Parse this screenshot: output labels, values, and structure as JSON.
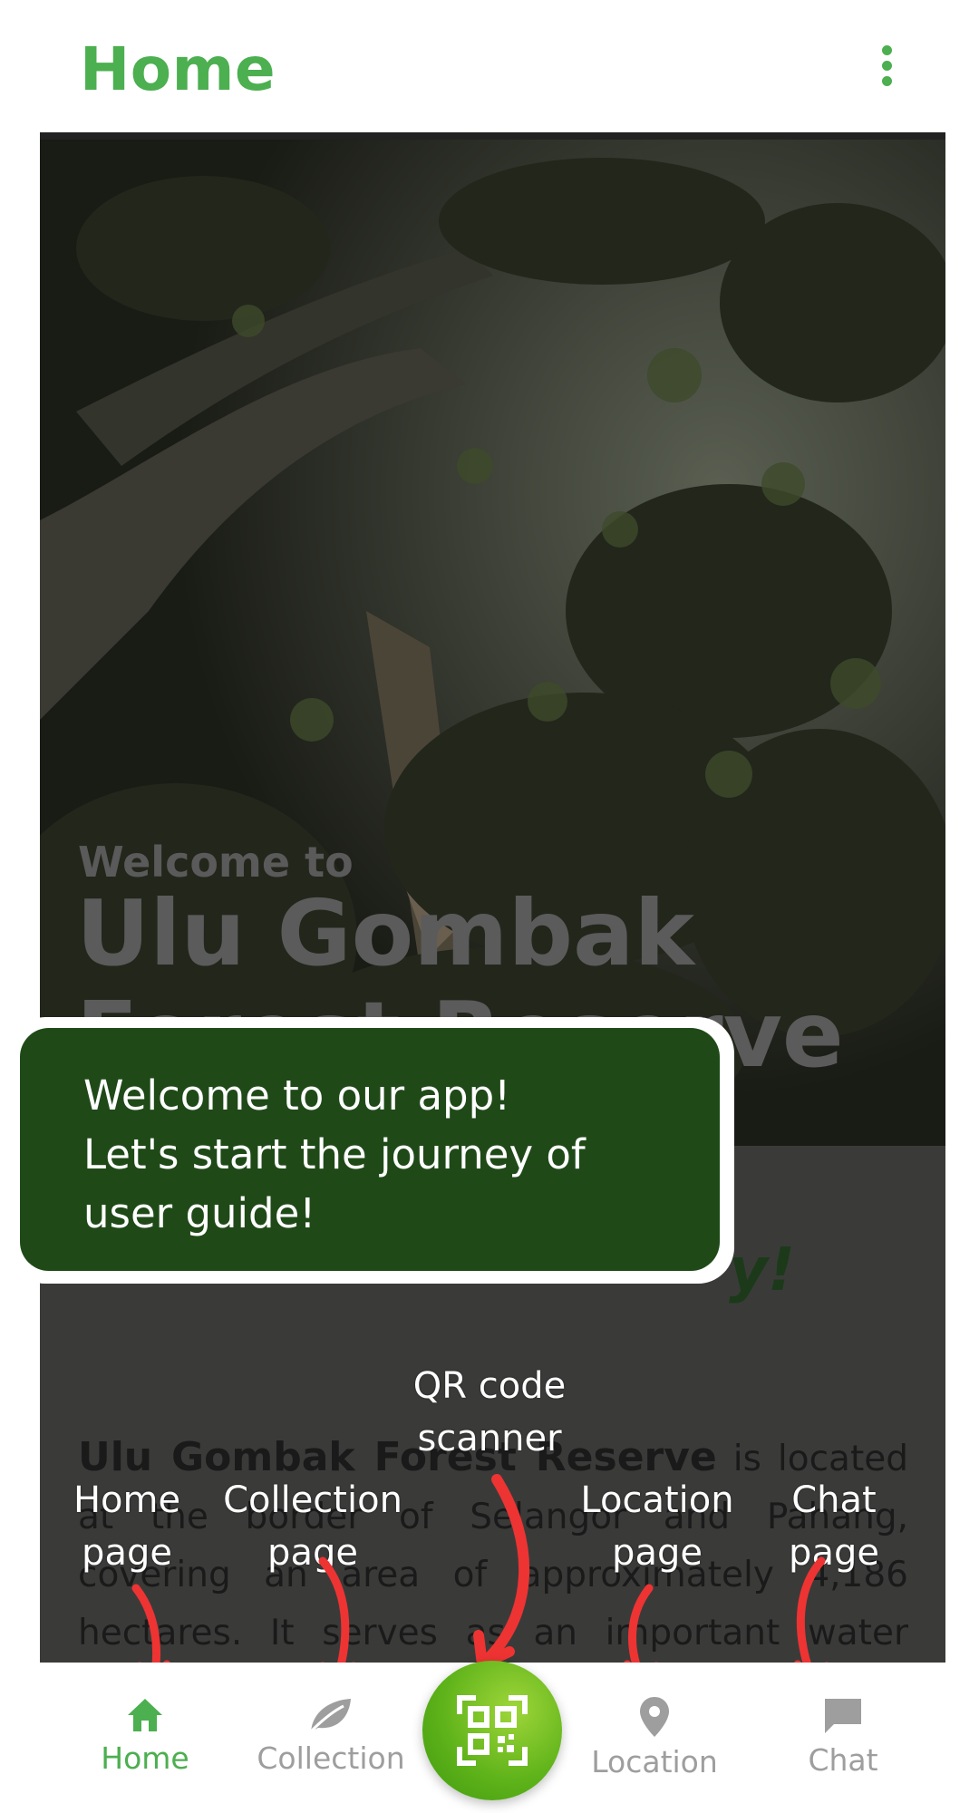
{
  "appbar": {
    "title": "Home"
  },
  "hero": {
    "welcome_small": "Welcome to",
    "welcome_big": "Ulu Gombak Forest Reserve"
  },
  "tagline": {
    "visible_tail": "y!"
  },
  "article": {
    "bold_name": "Ulu Gombak Forest Reserve",
    "text": " is located at the border of Selangor and Pahang, covering an area of approximately 4,186 hectares. It serves as an important water catchment area for the"
  },
  "guide": {
    "bubble_lines": [
      "Welcome to our app!",
      "Let's start the journey of",
      "user guide!"
    ],
    "labels": {
      "qr": "QR code scanner",
      "home": "Home page",
      "collection": "Collection page",
      "location": "Location page",
      "chat": "Chat page"
    }
  },
  "bottom_nav": {
    "items": [
      {
        "label": "Home",
        "icon": "home-icon",
        "active": true
      },
      {
        "label": "Collection",
        "icon": "leaf-icon",
        "active": false
      },
      {
        "label": "Location",
        "icon": "map-pin-icon",
        "active": false
      },
      {
        "label": "Chat",
        "icon": "chat-bubble-icon",
        "active": false
      }
    ],
    "fab_icon": "qr-code-icon"
  },
  "colors": {
    "accent": "#4caf50",
    "bubble_bg": "#1f4a18",
    "arrow": "#ee3333",
    "inactive_nav": "#9e9e9e"
  }
}
